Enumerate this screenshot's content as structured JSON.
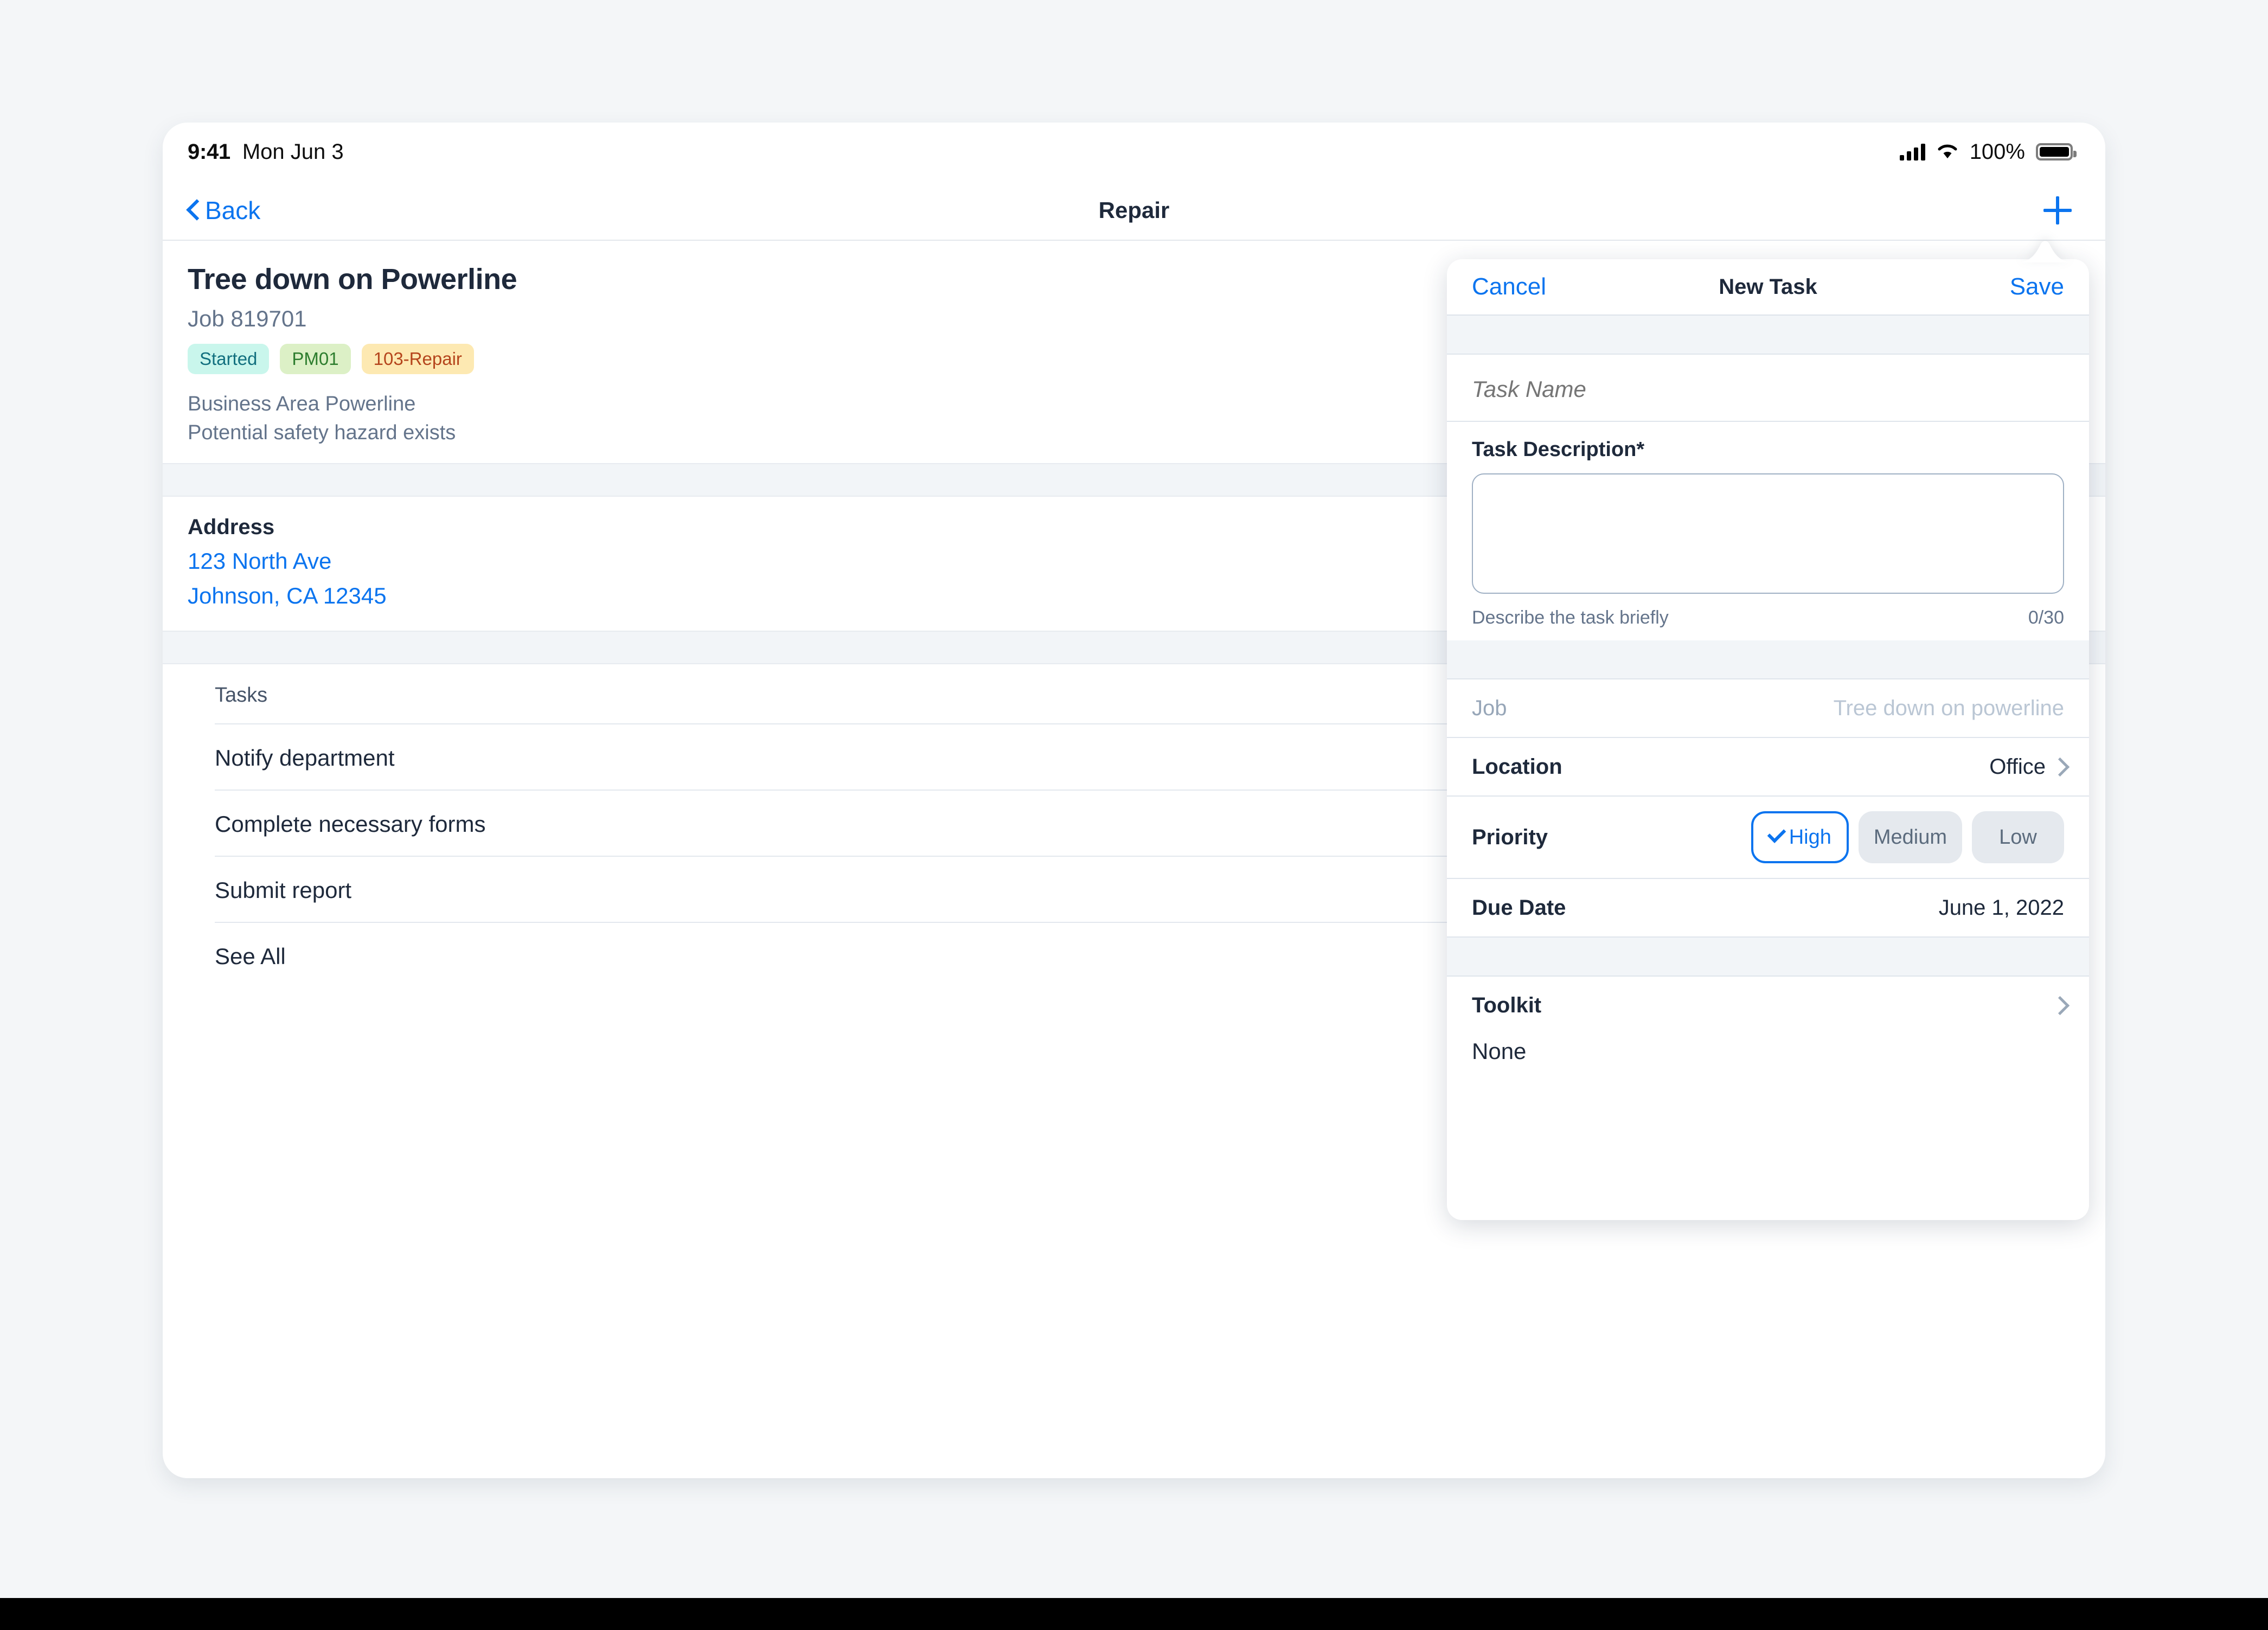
{
  "status_bar": {
    "time": "9:41",
    "date": "Mon Jun 3",
    "battery_percent": "100%",
    "signal_icon": "cellular-signal-icon",
    "wifi_icon": "wifi-icon",
    "battery_icon": "battery-full-icon"
  },
  "nav": {
    "back_label": "Back",
    "title": "Repair",
    "add_icon": "plus-icon"
  },
  "job": {
    "title": "Tree down on Powerline",
    "number": "Job 819701",
    "badges": [
      {
        "label": "Started",
        "bg": "#c9f6ec",
        "color": "#12707f"
      },
      {
        "label": "PM01",
        "bg": "#dcf0c6",
        "color": "#2d7d2e"
      },
      {
        "label": "103-Repair",
        "bg": "#fde9b2",
        "color": "#b5451c"
      }
    ],
    "business_area": "Business Area Powerline",
    "note": "Potential safety hazard exists"
  },
  "address": {
    "label": "Address",
    "line1": "123 North Ave",
    "line2": "Johnson, CA 12345"
  },
  "tasks": {
    "label": "Tasks",
    "items": [
      "Notify department",
      "Complete necessary forms",
      "Submit report",
      "See All"
    ]
  },
  "popover": {
    "cancel_label": "Cancel",
    "title": "New Task",
    "save_label": "Save",
    "task_name_placeholder": "Task Name",
    "task_name_value": "",
    "description_label": "Task Description*",
    "description_value": "",
    "description_hint": "Describe the task briefly",
    "description_counter": "0/30",
    "job_label": "Job",
    "job_value": "Tree down on powerline",
    "location_label": "Location",
    "location_value": "Office",
    "location_chevron_icon": "chevron-right-icon",
    "priority_label": "Priority",
    "priority_options": [
      "High",
      "Medium",
      "Low"
    ],
    "priority_selected": "High",
    "priority_check_icon": "check-icon",
    "due_date_label": "Due Date",
    "due_date_value": "June 1, 2022",
    "toolkit_label": "Toolkit",
    "toolkit_value": "None",
    "toolkit_chevron_icon": "chevron-right-icon"
  },
  "theme": {
    "accent": "#0b74ef",
    "text_primary": "#1e293b",
    "text_secondary": "#64748b",
    "background": "#f4f6f8"
  }
}
